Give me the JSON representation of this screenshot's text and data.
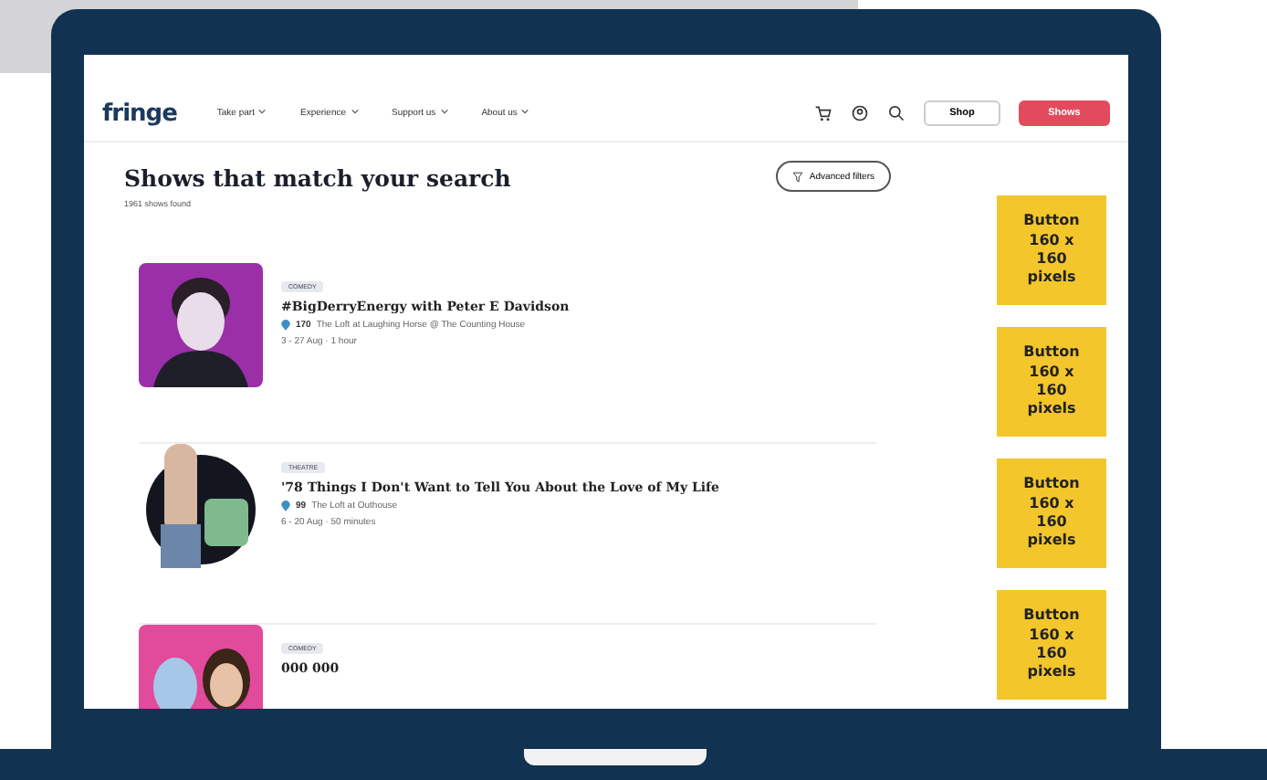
{
  "site": {
    "logo": "fringe",
    "nav": [
      {
        "label": "Take part"
      },
      {
        "label": "Experience"
      },
      {
        "label": "Support us"
      },
      {
        "label": "About us"
      }
    ],
    "shop_button": "Shop",
    "shows_button": "Shows"
  },
  "results": {
    "title": "Shows that match your search",
    "count": "1961 shows found",
    "filter_button": "Advanced filters"
  },
  "shows": [
    {
      "kind": "square",
      "category": "COMEDY",
      "title": "#BigDerryEnergy with Peter E Davidson",
      "venue_number": "170",
      "venue": "The Loft at Laughing Horse @ The Counting House",
      "dates": "3 - 27 Aug · 1 hour"
    },
    {
      "kind": "circle",
      "category": "THEATRE",
      "title": "'78 Things I Don't Want to Tell You About the Love of My Life",
      "venue_number": "99",
      "venue": "The Loft at Outhouse",
      "dates": "6 - 20 Aug · 50 minutes"
    },
    {
      "kind": "square",
      "category": "COMEDY",
      "title": "000 000"
    }
  ],
  "ads": [
    {
      "label": "Button 160 x 160 pixels"
    },
    {
      "label": "Button 160 x 160 pixels"
    },
    {
      "label": "Button 160 x 160 pixels"
    },
    {
      "label": "Button 160 x 160 pixels"
    }
  ]
}
